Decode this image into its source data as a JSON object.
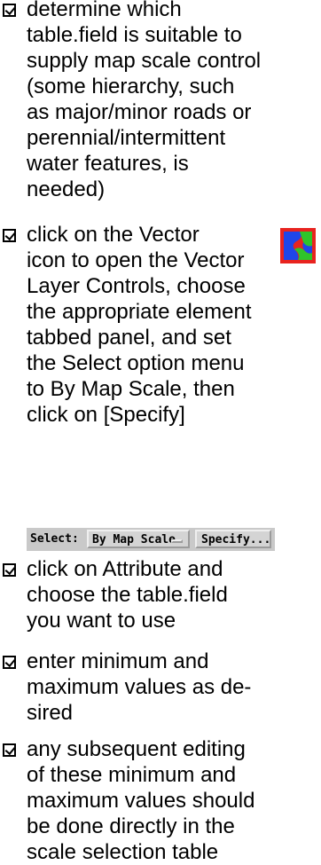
{
  "items": [
    {
      "text": "determine which\ntable.field is suitable to\nsupply map scale control\n(some hierarchy, such\nas major/minor roads or\nperennial/intermittent\nwater features, is\nneeded)"
    },
    {
      "text": "click on the Vector\nicon to open the Vector\nLayer Controls, choose\nthe appropriate element\ntabbed panel, and set\nthe Select option menu\nto By Map Scale, then\nclick on [Specify]"
    },
    {
      "text": "click on Attribute and\nchoose the table.field\nyou want to use"
    },
    {
      "text": "enter minimum and\nmaximum values as de-\nsired"
    },
    {
      "text": "any subsequent editing\nof these minimum and\nmaximum values should\nbe done directly in the\nscale selection table"
    }
  ],
  "vector_icon": {
    "icon": "vector-layer-icon",
    "colors": [
      "#e8231f",
      "#1f46e8",
      "#2fc42a"
    ]
  },
  "select_bar": {
    "label": "Select:",
    "menu_value": "By Map Scale",
    "button_label": "Specify..."
  }
}
